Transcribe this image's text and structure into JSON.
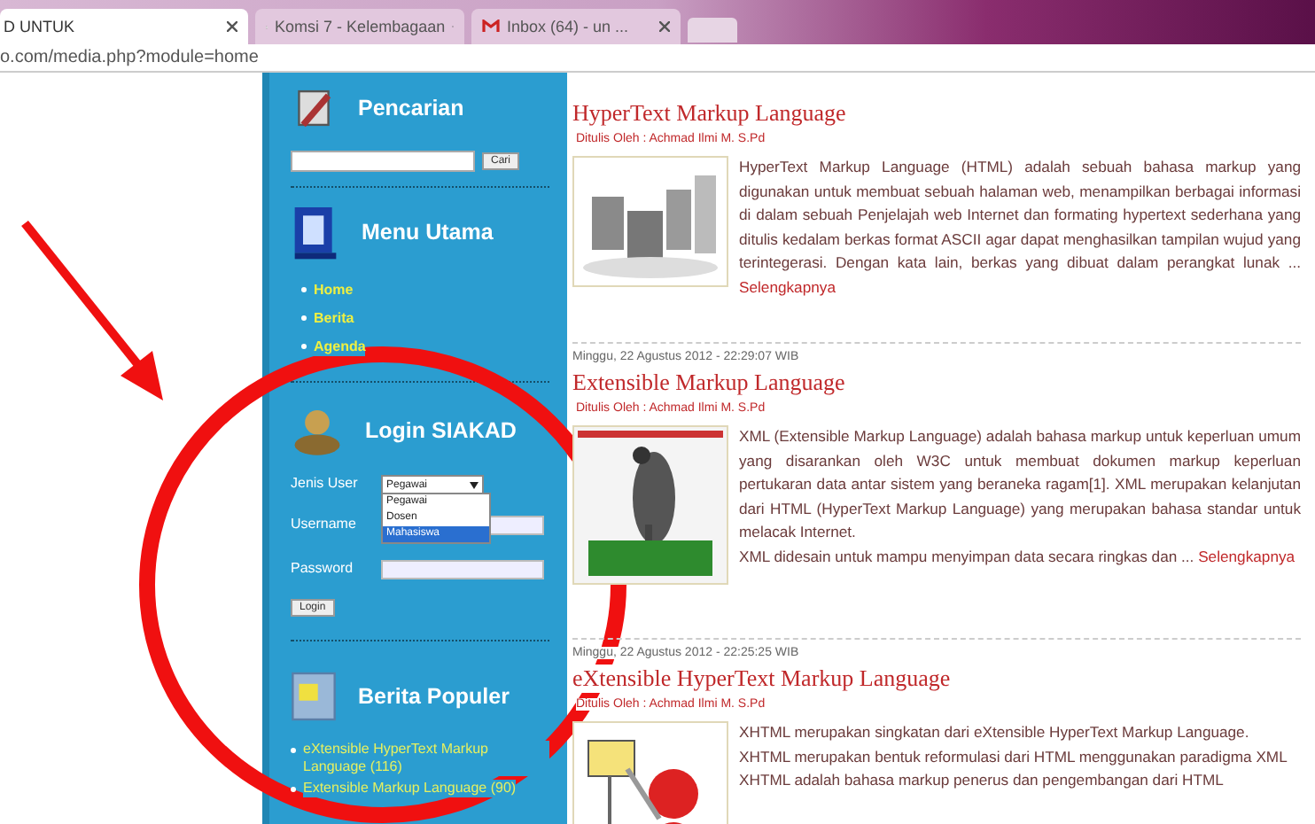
{
  "browser": {
    "tabs": [
      {
        "title": "D UNTUK",
        "selected": true
      },
      {
        "title": "Komsi 7 - Kelembagaan",
        "selected": false
      },
      {
        "title": "Inbox (64) - un ...",
        "selected": false
      }
    ],
    "address": "o.com/media.php?module=home"
  },
  "sidebar": {
    "search": {
      "title": "Pencarian",
      "button": "Cari"
    },
    "menu": {
      "title": "Menu Utama",
      "items": [
        "Home",
        "Berita",
        "Agenda"
      ]
    },
    "login": {
      "title": "Login SIAKAD",
      "user_type_label": "Jenis User",
      "user_type_value": "Pegawai",
      "options": [
        {
          "label": "Pegawai",
          "selected": false
        },
        {
          "label": "Dosen",
          "selected": false
        },
        {
          "label": "Mahasiswa",
          "selected": true
        }
      ],
      "username_label": "Username",
      "password_label": "Password",
      "button": "Login"
    },
    "popular": {
      "title": "Berita Populer",
      "items": [
        "eXtensible HyperText Markup Language (116)",
        "Extensible Markup Language (90)"
      ]
    }
  },
  "articles": [
    {
      "title": "HyperText Markup Language",
      "author": "Ditulis Oleh : Achmad Ilmi M. S.Pd",
      "paragraphs": [
        "HyperText Markup Language (HTML) adalah sebuah bahasa markup yang digunakan untuk membuat sebuah halaman web, menampilkan berbagai informasi di dalam sebuah Penjelajah web Internet dan formating hypertext sederhana yang ditulis kedalam berkas format ASCII agar dapat menghasilkan tampilan wujud yang terintegerasi. Dengan kata lain, berkas yang dibuat dalam perangkat lunak ..."
      ],
      "more": "Selengkapnya",
      "kind": "picture"
    },
    {
      "date": "Minggu, 22 Agustus 2012 - 22:29:07 WIB",
      "title": "Extensible Markup Language",
      "author": "Ditulis Oleh : Achmad Ilmi M. S.Pd",
      "paragraphs": [
        "XML (Extensible Markup Language) adalah bahasa markup untuk keperluan umum yang disarankan oleh W3C untuk membuat dokumen markup keperluan pertukaran data antar sistem yang beraneka ragam[1]. XML merupakan kelanjutan dari HTML (HyperText Markup Language) yang merupakan bahasa standar untuk melacak Internet.",
        "XML didesain untuk mampu menyimpan data secara ringkas dan ..."
      ],
      "more": "Selengkapnya",
      "kind": "picture"
    },
    {
      "date": "Minggu, 22 Agustus 2012 - 22:25:25 WIB",
      "title": "eXtensible HyperText Markup Language",
      "author": "Ditulis Oleh : Achmad Ilmi M. S.Pd",
      "paragraphs": [
        "XHTML merupakan singkatan dari eXtensible HyperText Markup Language.",
        "XHTML merupakan bentuk reformulasi dari HTML menggunakan paradigma XML",
        "XHTML adalah bahasa markup penerus dan pengembangan dari HTML"
      ],
      "kind": "picture"
    }
  ]
}
